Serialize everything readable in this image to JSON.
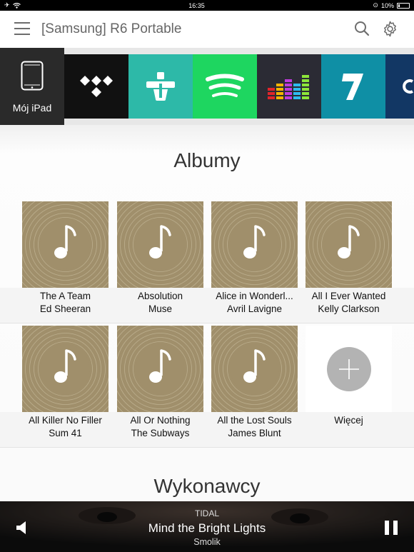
{
  "status_bar": {
    "time": "16:35",
    "battery": "10%"
  },
  "header": {
    "title": "[Samsung] R6 Portable"
  },
  "sources": {
    "local_label": "Mój iPad",
    "services": [
      "tidal-logo",
      "tunein-logo",
      "spotify-logo",
      "deezer-logo",
      "7digital-logo",
      "more-service-logo"
    ],
    "colors": {
      "tidal": "#111111",
      "tunein": "#2db9a8",
      "spotify": "#1ed660",
      "deezer": "#2b2b34",
      "sevendigital": "#0f8fa5"
    }
  },
  "albums_section": {
    "title": "Albumy",
    "items": [
      {
        "title": "The A Team",
        "artist": "Ed Sheeran"
      },
      {
        "title": "Absolution",
        "artist": "Muse"
      },
      {
        "title": "Alice in Wonderl...",
        "artist": "Avril Lavigne"
      },
      {
        "title": "All I Ever Wanted",
        "artist": "Kelly Clarkson"
      },
      {
        "title": "All Killer No Filler",
        "artist": "Sum 41"
      },
      {
        "title": "All Or Nothing",
        "artist": "The Subways"
      },
      {
        "title": "All the Lost Souls",
        "artist": "James Blunt"
      }
    ],
    "more_label": "Więcej"
  },
  "artists_section": {
    "title": "Wykonawcy"
  },
  "now_playing": {
    "source": "TIDAL",
    "track": "Mind the Bright Lights",
    "artist": "Smolik"
  }
}
